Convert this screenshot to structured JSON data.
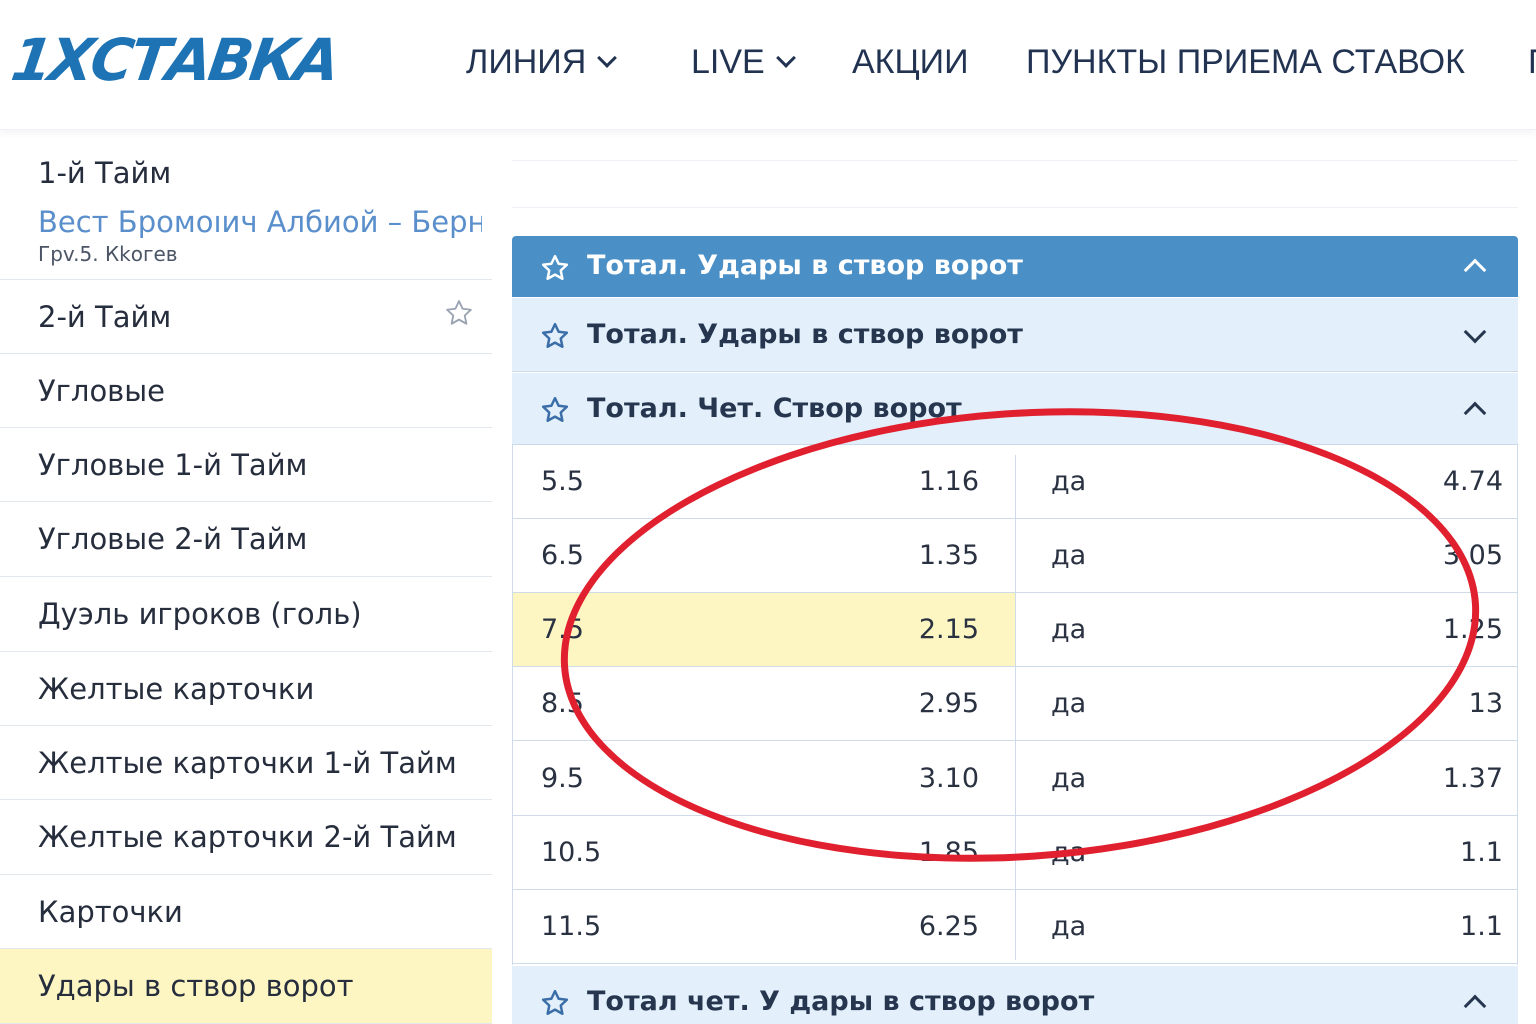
{
  "header": {
    "logo": "1XСТАВКА",
    "nav": [
      {
        "label": "ЛИНИЯ",
        "dropdown": true
      },
      {
        "label": "LIVE",
        "dropdown": true
      },
      {
        "label": "АКЦИИ",
        "dropdown": false
      },
      {
        "label": "ПУНКТЫ ПРИЕМА СТАВОК",
        "dropdown": false
      }
    ],
    "nav_cut": "П"
  },
  "sidebar": {
    "first": {
      "label": "1-й Тайм",
      "match": "Вест Бромоıич Албиой – Берні",
      "sub": "Грv.5. Кkогев"
    },
    "items": [
      {
        "label": "2-й Тайм",
        "star": true
      },
      {
        "label": "Угловые"
      },
      {
        "label": "Угловые 1-й Тайм"
      },
      {
        "label": "Угловые 2-й Тайм"
      },
      {
        "label": "Дуэль игроков (голь)"
      },
      {
        "label": "Желтые карточки"
      },
      {
        "label": "Желтые карточки 1-й Тайм"
      },
      {
        "label": "Желтые карточки 2-й Тайм"
      },
      {
        "label": "Карточки"
      },
      {
        "label": "Удары в створ ворот",
        "active": true
      }
    ]
  },
  "markets": {
    "primary_title": "Тотал. Удары в створ ворот",
    "sub1_title": "Тотал. Удары в створ ворот",
    "sub2_title": "Тотал. Чет. Створ ворот",
    "bottom_title": "Тотал чет. У дары в створ ворот"
  },
  "table": {
    "rows": [
      {
        "total": "5.5",
        "odd1": "1.16",
        "label": "да",
        "odd2": "4.74"
      },
      {
        "total": "6.5",
        "odd1": "1.35",
        "label": "да",
        "odd2": "3.05"
      },
      {
        "total": "7.5",
        "odd1": "2.15",
        "label": "да",
        "odd2": "1.25",
        "highlight": true
      },
      {
        "total": "8.5",
        "odd1": "2.95",
        "label": "да",
        "odd2": "13"
      },
      {
        "total": "9.5",
        "odd1": "3.10",
        "label": "да",
        "odd2": "1.37"
      },
      {
        "total": "10.5",
        "odd1": "1.85",
        "label": "да",
        "odd2": "1.1"
      },
      {
        "total": "11.5",
        "odd1": "6.25",
        "label": "да",
        "odd2": "1.1"
      }
    ]
  },
  "colors": {
    "brand_blue": "#1d73b4",
    "header_blue": "#4a8fc6",
    "subheader_bg": "#e3f0fb",
    "highlight_yellow": "#fdf6c3",
    "annotation_red": "#e0202e"
  }
}
